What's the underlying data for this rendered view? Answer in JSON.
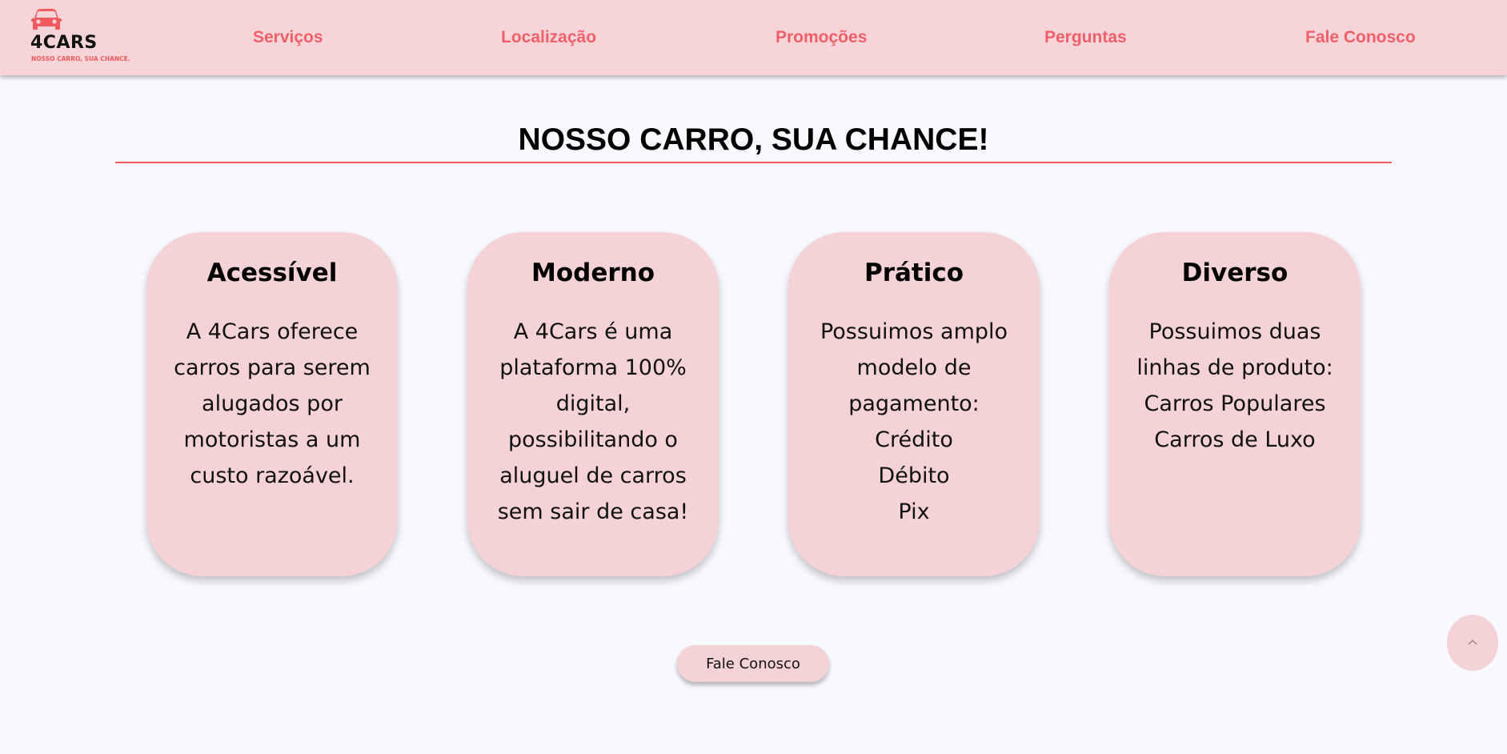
{
  "brand": {
    "name": "4CARS",
    "tagline": "NOSSO CARRO, SUA CHANCE.",
    "accent_color": "#f0606a",
    "surface_color": "#f6d4d7"
  },
  "nav": {
    "items": [
      {
        "label": "Serviços"
      },
      {
        "label": "Localização"
      },
      {
        "label": "Promoções"
      },
      {
        "label": "Perguntas"
      },
      {
        "label": "Fale Conosco"
      }
    ]
  },
  "hero": {
    "title": "NOSSO CARRO, SUA CHANCE!"
  },
  "cards": [
    {
      "title": "Acessível",
      "lines": [
        "A 4Cars oferece",
        "carros para serem",
        "alugados por",
        "motoristas a um",
        "custo razoável."
      ]
    },
    {
      "title": "Moderno",
      "lines": [
        "A 4Cars é uma",
        "plataforma 100%",
        "digital,",
        "possibilitando o",
        "aluguel de carros",
        "sem sair de casa!"
      ]
    },
    {
      "title": "Prático",
      "lines": [
        "Possuimos amplo",
        "modelo de",
        "pagamento:",
        "Crédito",
        "Débito",
        "Pix"
      ]
    },
    {
      "title": "Diverso",
      "lines": [
        "Possuimos duas",
        "linhas de produto:",
        "Carros Populares",
        "Carros de Luxo"
      ]
    }
  ],
  "cta": {
    "label": "Fale Conosco"
  },
  "scroll_top": {
    "icon": "chevron-up-icon"
  }
}
